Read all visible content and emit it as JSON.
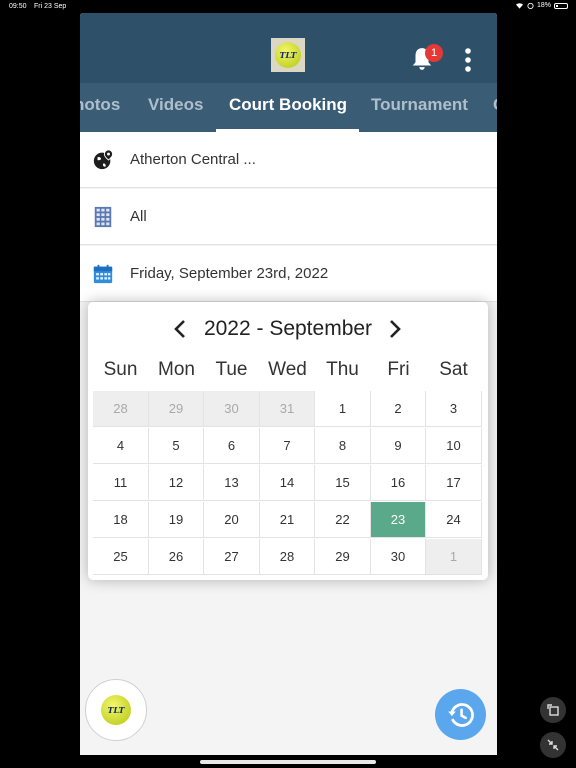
{
  "status_bar": {
    "time": "09:50",
    "date": "Fri 23 Sep",
    "battery": "18%"
  },
  "header": {
    "logo_text": "TLT",
    "notification_count": "1"
  },
  "tabs": [
    {
      "label": "hotos"
    },
    {
      "label": "Videos"
    },
    {
      "label": "Court Booking",
      "active": true
    },
    {
      "label": "Tournament"
    },
    {
      "label": "C"
    }
  ],
  "filters": {
    "location": "Atherton Central ...",
    "court": "All",
    "date": "Friday, September 23rd, 2022"
  },
  "calendar": {
    "title": "2022 - September",
    "weekdays": [
      "Sun",
      "Mon",
      "Tue",
      "Wed",
      "Thu",
      "Fri",
      "Sat"
    ],
    "weeks": [
      [
        {
          "d": "28",
          "o": true
        },
        {
          "d": "29",
          "o": true
        },
        {
          "d": "30",
          "o": true
        },
        {
          "d": "31",
          "o": true
        },
        {
          "d": "1"
        },
        {
          "d": "2"
        },
        {
          "d": "3"
        }
      ],
      [
        {
          "d": "4"
        },
        {
          "d": "5"
        },
        {
          "d": "6"
        },
        {
          "d": "7"
        },
        {
          "d": "8"
        },
        {
          "d": "9"
        },
        {
          "d": "10"
        }
      ],
      [
        {
          "d": "11"
        },
        {
          "d": "12"
        },
        {
          "d": "13"
        },
        {
          "d": "14"
        },
        {
          "d": "15"
        },
        {
          "d": "16"
        },
        {
          "d": "17"
        }
      ],
      [
        {
          "d": "18"
        },
        {
          "d": "19"
        },
        {
          "d": "20"
        },
        {
          "d": "21"
        },
        {
          "d": "22"
        },
        {
          "d": "23",
          "s": true
        },
        {
          "d": "24"
        }
      ],
      [
        {
          "d": "25"
        },
        {
          "d": "26"
        },
        {
          "d": "27"
        },
        {
          "d": "28"
        },
        {
          "d": "29"
        },
        {
          "d": "30"
        },
        {
          "d": "1",
          "o": true
        }
      ]
    ],
    "selected_color": "#5aa98b"
  },
  "colors": {
    "header": "#2e5068",
    "tabs": "#3a5d75",
    "fab": "#5aa7ee"
  },
  "icons": {
    "location": "globe-pin-icon",
    "court": "grid-icon",
    "date": "calendar-icon",
    "history": "history-icon",
    "notifications": "bell-icon",
    "menu": "more-vertical-icon"
  }
}
